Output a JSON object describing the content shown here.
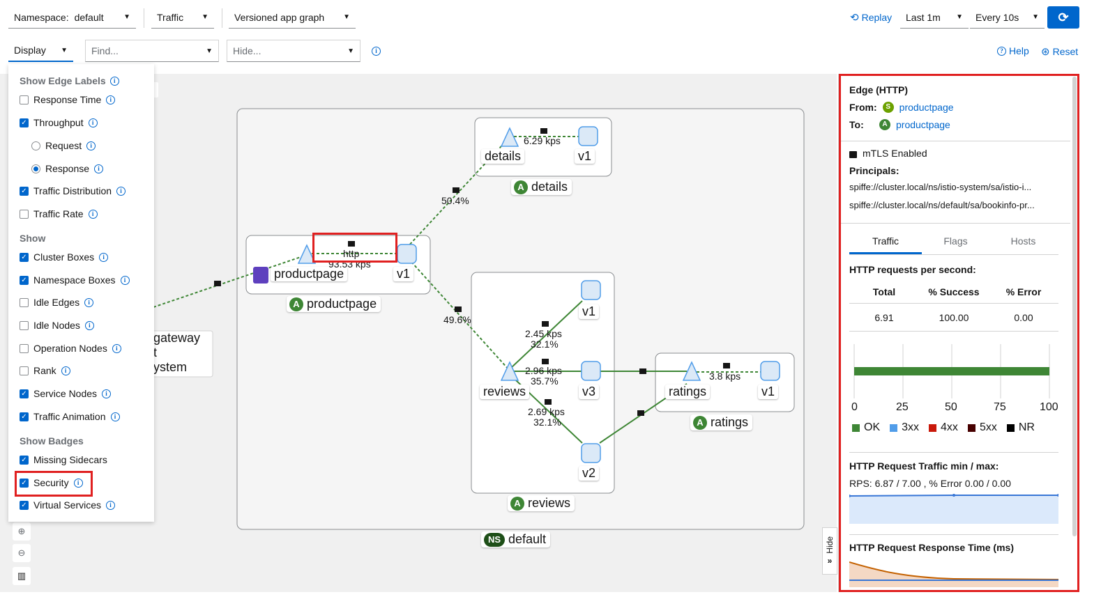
{
  "toolbar": {
    "namespace_label": "Namespace:",
    "namespace_value": "default",
    "traffic_label": "Traffic",
    "graph_type": "Versioned app graph",
    "replay_label": "Replay",
    "duration": "Last 1m",
    "refresh_interval": "Every 10s",
    "display_label": "Display",
    "find_placeholder": "Find...",
    "hide_placeholder": "Hide...",
    "help_label": "Help",
    "reset_label": "Reset"
  },
  "display_menu": {
    "edge_labels_heading": "Show Edge Labels",
    "response_time": "Response Time",
    "throughput": "Throughput",
    "request": "Request",
    "response": "Response",
    "traffic_distribution": "Traffic Distribution",
    "traffic_rate": "Traffic Rate",
    "show_heading": "Show",
    "cluster_boxes": "Cluster Boxes",
    "namespace_boxes": "Namespace Boxes",
    "idle_edges": "Idle Edges",
    "idle_nodes": "Idle Nodes",
    "operation_nodes": "Operation Nodes",
    "rank": "Rank",
    "service_nodes": "Service Nodes",
    "traffic_animation": "Traffic Animation",
    "badges_heading": "Show Badges",
    "missing_sidecars": "Missing Sidecars",
    "security": "Security",
    "virtual_services": "Virtual Services"
  },
  "graph": {
    "namespace_box": "default",
    "ns_badge": "NS",
    "app_badge": "A",
    "productpage_box": "productpage",
    "details_box": "details",
    "reviews_box": "reviews",
    "ratings_box": "ratings",
    "productpage_node": "productpage",
    "productpage_v1": "v1",
    "details_node": "details",
    "details_v1": "v1",
    "reviews_node": "reviews",
    "reviews_v1": "v1",
    "reviews_v2": "v2",
    "reviews_v3": "v3",
    "ratings_node": "ratings",
    "ratings_v1": "v1",
    "gateway_lines": [
      "gateway",
      "t",
      "ystem"
    ],
    "edge_http": "http",
    "edge_pp_kps": "93.53 kps",
    "edge_details_kps": "6.29 kps",
    "edge_details_pct": "50.4%",
    "edge_reviews_pct": "49.6%",
    "edge_v1_kps": "2.45 kps",
    "edge_v1_pct": "32.1%",
    "edge_v3_kps": "2.96 kps",
    "edge_v3_pct": "35.7%",
    "edge_v2_kps": "2.69 kps",
    "edge_v2_pct": "32.1%",
    "edge_ratings_kps": "3.8 kps"
  },
  "side_panel": {
    "title": "Edge (HTTP)",
    "from_label": "From:",
    "from_badge": "S",
    "from_value": "productpage",
    "to_label": "To:",
    "to_badge": "A",
    "to_value": "productpage",
    "mtls": "mTLS Enabled",
    "principals_label": "Principals:",
    "principal_1": "spiffe://cluster.local/ns/istio-system/sa/istio-i...",
    "principal_2": "spiffe://cluster.local/ns/default/sa/bookinfo-pr...",
    "tabs": [
      "Traffic",
      "Flags",
      "Hosts"
    ],
    "rps_heading": "HTTP requests per second:",
    "col_total": "Total",
    "col_success": "% Success",
    "col_error": "% Error",
    "val_total": "6.91",
    "val_success": "100.00",
    "val_error": "0.00",
    "axis_ticks": [
      "0",
      "25",
      "50",
      "75",
      "100"
    ],
    "success_fraction": 1.0,
    "legend": [
      {
        "label": "OK",
        "color": "#3e8635"
      },
      {
        "label": "3xx",
        "color": "#519de9"
      },
      {
        "label": "4xx",
        "color": "#c9190b"
      },
      {
        "label": "5xx",
        "color": "#470000"
      },
      {
        "label": "NR",
        "color": "#000000"
      }
    ],
    "minmax_heading": "HTTP Request Traffic min / max:",
    "minmax_value": "RPS: 6.87 / 7.00 , % Error 0.00 / 0.00",
    "response_time_heading": "HTTP Request Response Time (ms)",
    "hide_label": "Hide"
  }
}
